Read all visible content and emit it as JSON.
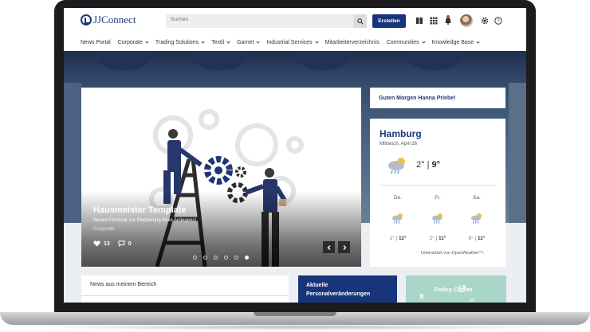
{
  "header": {
    "logo_text": "JJConnect",
    "search_placeholder": "Suchen",
    "create_label": "Erstellen"
  },
  "nav": {
    "items": [
      {
        "label": "News Portal",
        "dropdown": false
      },
      {
        "label": "Corporate",
        "dropdown": true
      },
      {
        "label": "Trading Solutions",
        "dropdown": true
      },
      {
        "label": "Textil",
        "dropdown": true
      },
      {
        "label": "Garnet",
        "dropdown": true
      },
      {
        "label": "Industrial Services",
        "dropdown": true
      },
      {
        "label": "Mitarbeiterverzeichnis",
        "dropdown": false
      },
      {
        "label": "Communities",
        "dropdown": true
      },
      {
        "label": "Knowledge Base",
        "dropdown": true
      }
    ]
  },
  "hero_card": {
    "title": "Hausmeister Template",
    "subtitle": "Neues Formular zur Platzierung Ihres Anliegens!",
    "category": "Corporate",
    "likes": "13",
    "comments": "0",
    "slides": 6,
    "active_slide": 6
  },
  "greeting": "Guten Morgen Hanna Priebe!",
  "weather": {
    "city": "Hamburg",
    "date": "Mittwoch, April 26",
    "current_low": "2°",
    "current_high": "9°",
    "forecast": [
      {
        "day": "Do.",
        "low": "1°",
        "high": "11°"
      },
      {
        "day": "Fr.",
        "low": "2°",
        "high": "11°"
      },
      {
        "day": "Sa.",
        "low": "8°",
        "high": "11°"
      }
    ],
    "credit": "Unterstützt von OpenWeather™."
  },
  "tiles": {
    "news_title": "News aus meinem Bereich",
    "personal_title": "Aktuelle Personalveränderungen",
    "policy_title": "Policy Center"
  },
  "colors": {
    "brand": "#17357a",
    "policy_tile": "#a9d6c8",
    "notification": "#e5312b"
  }
}
